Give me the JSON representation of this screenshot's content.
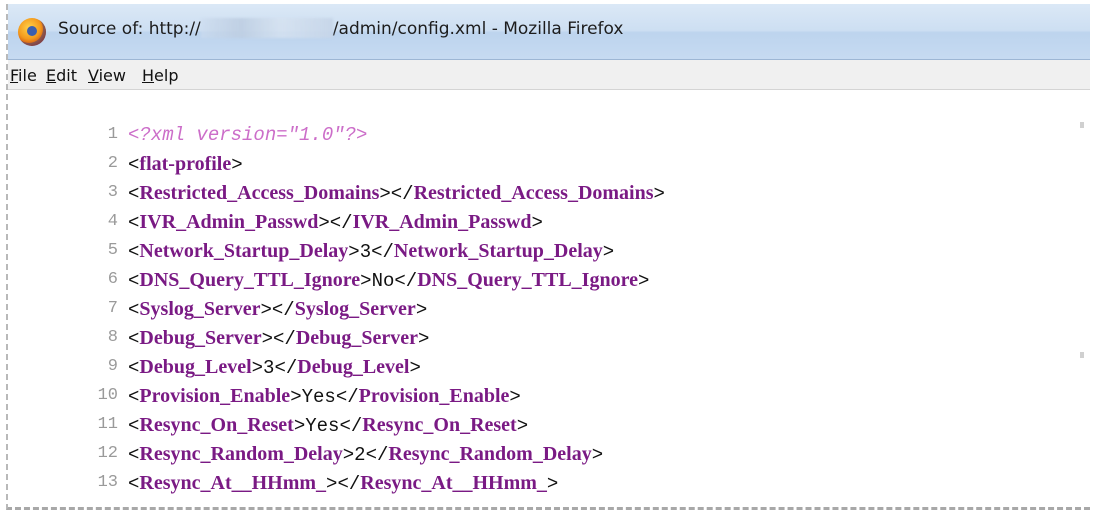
{
  "window": {
    "title_prefix": "Source of: http://",
    "title_suffix": "/admin/config.xml - Mozilla Firefox"
  },
  "menu": {
    "items": [
      {
        "mnemonic": "F",
        "rest": "ile"
      },
      {
        "mnemonic": "E",
        "rest": "dit"
      },
      {
        "mnemonic": "V",
        "rest": "iew"
      },
      {
        "mnemonic": "H",
        "rest": "elp"
      }
    ]
  },
  "source": {
    "lines": [
      {
        "num": "1",
        "pi": "<?xml version=\"1.0\"?>"
      },
      {
        "num": "2",
        "open": "flat-profile"
      },
      {
        "num": "3",
        "open": "Restricted_Access_Domains",
        "value": "",
        "close": "Restricted_Access_Domains"
      },
      {
        "num": "4",
        "open": "IVR_Admin_Passwd",
        "value": "",
        "close": "IVR_Admin_Passwd"
      },
      {
        "num": "5",
        "open": "Network_Startup_Delay",
        "value": "3",
        "close": "Network_Startup_Delay"
      },
      {
        "num": "6",
        "open": "DNS_Query_TTL_Ignore",
        "value": "No",
        "close": "DNS_Query_TTL_Ignore"
      },
      {
        "num": "7",
        "open": "Syslog_Server",
        "value": "",
        "close": "Syslog_Server"
      },
      {
        "num": "8",
        "open": "Debug_Server",
        "value": "",
        "close": "Debug_Server"
      },
      {
        "num": "9",
        "open": "Debug_Level",
        "value": "3",
        "close": "Debug_Level"
      },
      {
        "num": "10",
        "open": "Provision_Enable",
        "value": "Yes",
        "close": "Provision_Enable"
      },
      {
        "num": "11",
        "open": "Resync_On_Reset",
        "value": "Yes",
        "close": "Resync_On_Reset"
      },
      {
        "num": "12",
        "open": "Resync_Random_Delay",
        "value": "2",
        "close": "Resync_Random_Delay"
      },
      {
        "num": "13",
        "open": "Resync_At__HHmm_",
        "value": "",
        "close": "Resync_At__HHmm_"
      }
    ]
  }
}
